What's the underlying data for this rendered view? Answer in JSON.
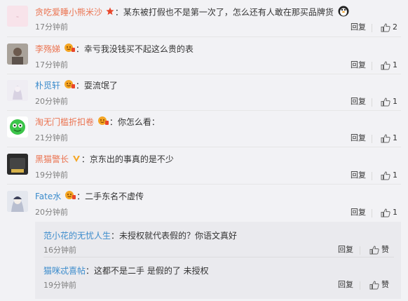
{
  "comments": [
    {
      "user": "贪吃爱睡小熊米沙",
      "text": "某东被打假也不是第一次了，怎么还有人敢在那买品牌货",
      "time": "17分钟前",
      "reply": "回复",
      "likes": "2",
      "avatar_color": "#f6dde4",
      "name_color": "#eb7350"
    },
    {
      "user": "李殇娣",
      "text": "幸亏我没钱买不起这么贵的表",
      "time": "17分钟前",
      "reply": "回复",
      "likes": "1",
      "avatar_color": "#b8b0a8",
      "name_color": "#eb7350"
    },
    {
      "user": "朴觅轩",
      "text": "耍流氓了",
      "time": "20分钟前",
      "reply": "回复",
      "likes": "1",
      "avatar_color": "#e8e4ef",
      "name_color": "#3c8ccc"
    },
    {
      "user": "淘无门槛折扣卷",
      "text": "你怎么看：",
      "time": "21分钟前",
      "reply": "回复",
      "likes": "1",
      "avatar_color": "#c9f0c0",
      "name_color": "#eb7350"
    },
    {
      "user": "黑猫警长",
      "text": "京东出的事真的是不少",
      "time": "19分钟前",
      "reply": "回复",
      "likes": "1",
      "avatar_color": "#3a3a3a",
      "name_color": "#eb7350"
    },
    {
      "user": "Fate水",
      "text": "二手东名不虚传",
      "time": "20分钟前",
      "reply": "回复",
      "likes": "1",
      "avatar_color": "#d7dce6",
      "name_color": "#3c8ccc"
    }
  ],
  "replies": [
    {
      "user": "范小花的无忧人生",
      "text": "未授权就代表假的？你语文真好",
      "time": "16分钟前",
      "reply": "回复",
      "like_label": "赞"
    },
    {
      "user": "猫咪忒喜帖",
      "text": "这都不是二手 是假的了 未授权",
      "time": "19分钟前",
      "reply": "回复",
      "like_label": "赞"
    }
  ]
}
